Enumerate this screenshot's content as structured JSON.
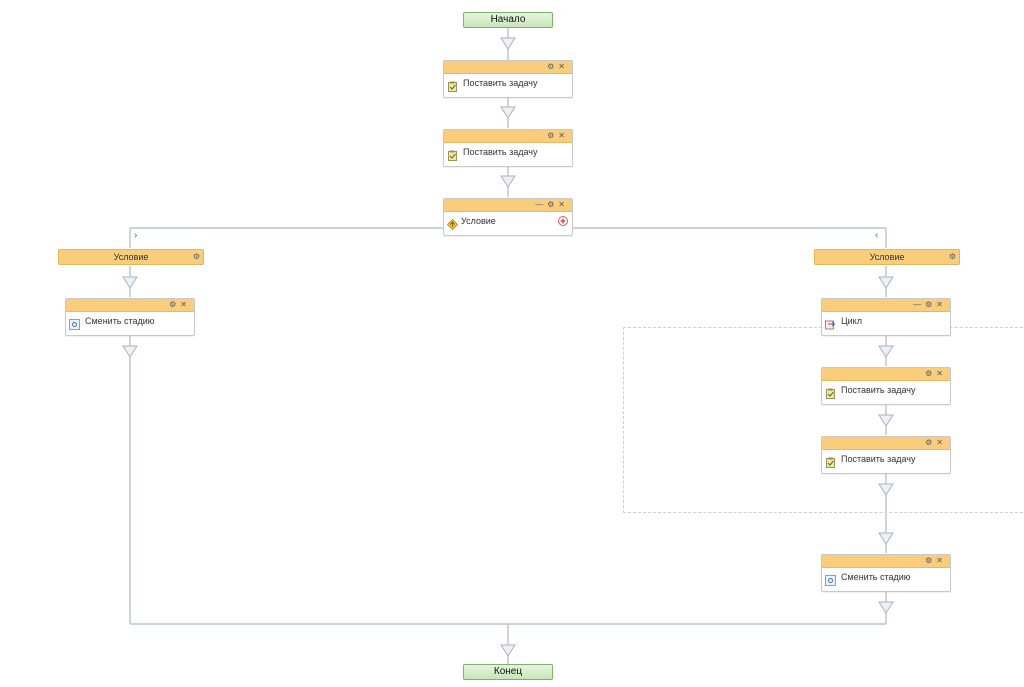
{
  "start": {
    "label": "Начало"
  },
  "end": {
    "label": "Конец"
  },
  "main": {
    "task1": {
      "label": "Поставить задачу"
    },
    "task2": {
      "label": "Поставить задачу"
    },
    "condition": {
      "label": "Условие"
    }
  },
  "left_branch": {
    "condition": {
      "label": "Условие"
    },
    "set_stage": {
      "label": "Сменить стадию"
    }
  },
  "right_branch": {
    "condition": {
      "label": "Условие"
    },
    "loop": {
      "label": "Цикл"
    },
    "task1": {
      "label": "Поставить задачу"
    },
    "task2": {
      "label": "Поставить задачу"
    },
    "set_stage": {
      "label": "Сменить стадию"
    }
  },
  "controls": {
    "settings": "⚙",
    "close": "✕",
    "collapse": "—"
  },
  "colors": {
    "header": "#f9cd7c",
    "terminal": "#c7e6b8",
    "connector": "#b9c3cf"
  }
}
